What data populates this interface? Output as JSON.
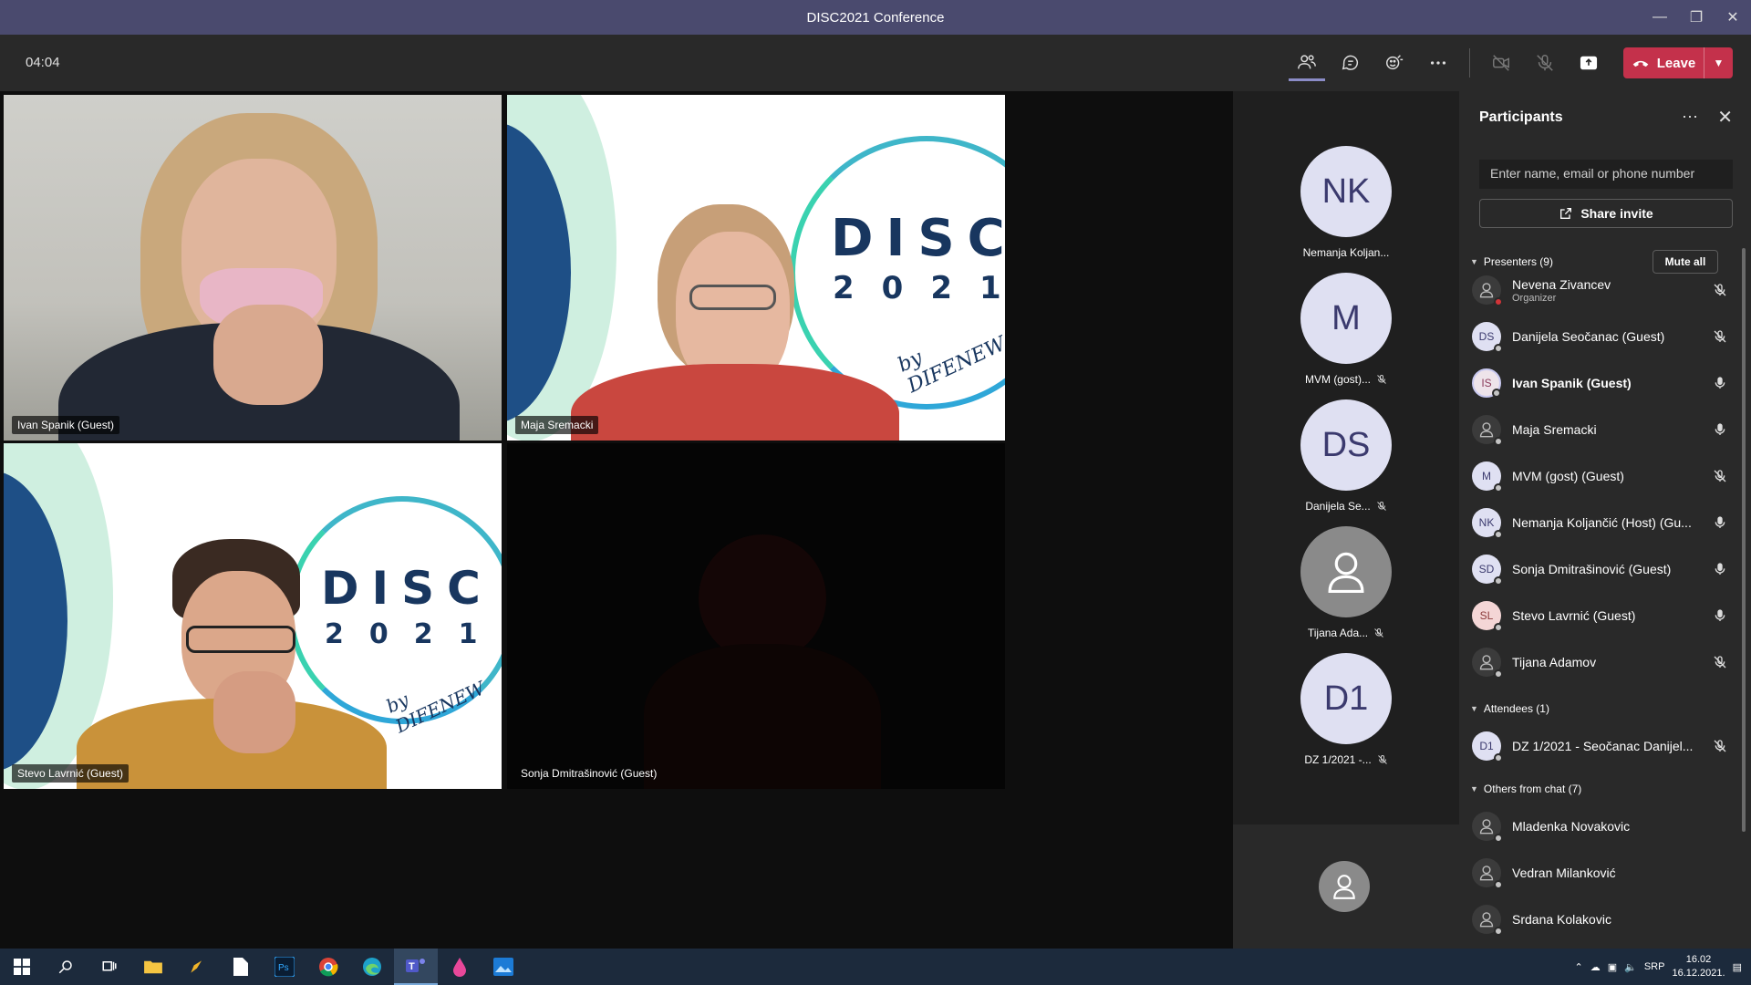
{
  "window": {
    "title": "DISC2021 Conference"
  },
  "toolbar": {
    "timer": "04:04",
    "leave_label": "Leave"
  },
  "tiles": [
    {
      "name": "Ivan Spanik (Guest)"
    },
    {
      "name": "Maja Sremacki"
    },
    {
      "name": "Stevo Lavrnić (Guest)"
    },
    {
      "name": "Sonja Dmitrašinović (Guest)"
    }
  ],
  "brand": {
    "line1": "DISC",
    "line2": "2021",
    "by": "by DIFENEW"
  },
  "strip": [
    {
      "initials": "NK",
      "name": "Nemanja Koljan..."
    },
    {
      "initials": "M",
      "name": "MVM (gost)..."
    },
    {
      "initials": "DS",
      "name": "Danijela Se..."
    },
    {
      "initials": "",
      "name": "Tijana Ada..."
    },
    {
      "initials": "D1",
      "name": "DZ 1/2021 -..."
    }
  ],
  "panel": {
    "title": "Participants",
    "search_placeholder": "Enter name, email or phone number",
    "share_label": "Share invite",
    "presenters_label": "Presenters (9)",
    "mute_all_label": "Mute all",
    "attendees_label": "Attendees (1)",
    "others_label": "Others from chat (7)",
    "presenters": [
      {
        "name": "Nevena Zivancev",
        "sub": "Organizer",
        "mic": "muted"
      },
      {
        "initials": "DS",
        "name": "Danijela Seočanac (Guest)",
        "mic": "muted"
      },
      {
        "initials": "IS",
        "name": "Ivan Spanik (Guest)",
        "mic": "on"
      },
      {
        "name": "Maja Sremacki",
        "mic": "on"
      },
      {
        "initials": "M",
        "name": "MVM (gost) (Guest)",
        "mic": "muted"
      },
      {
        "initials": "NK",
        "name": "Nemanja Koljančić (Host) (Gu...",
        "mic": "on"
      },
      {
        "initials": "SD",
        "name": "Sonja Dmitrašinović (Guest)",
        "mic": "on"
      },
      {
        "initials": "SL",
        "name": "Stevo Lavrnić (Guest)",
        "mic": "on"
      },
      {
        "name": "Tijana Adamov",
        "mic": "muted"
      }
    ],
    "attendees": [
      {
        "initials": "D1",
        "name": "DZ 1/2021 - Seočanac Danijel...",
        "mic": "muted"
      }
    ],
    "others": [
      {
        "name": "Mladenka Novakovic"
      },
      {
        "name": "Vedran Milanković"
      },
      {
        "name": "Srdana Kolakovic"
      }
    ]
  },
  "taskbar": {
    "lang": "SRP",
    "time": "16.02",
    "date": "16.12.2021."
  }
}
